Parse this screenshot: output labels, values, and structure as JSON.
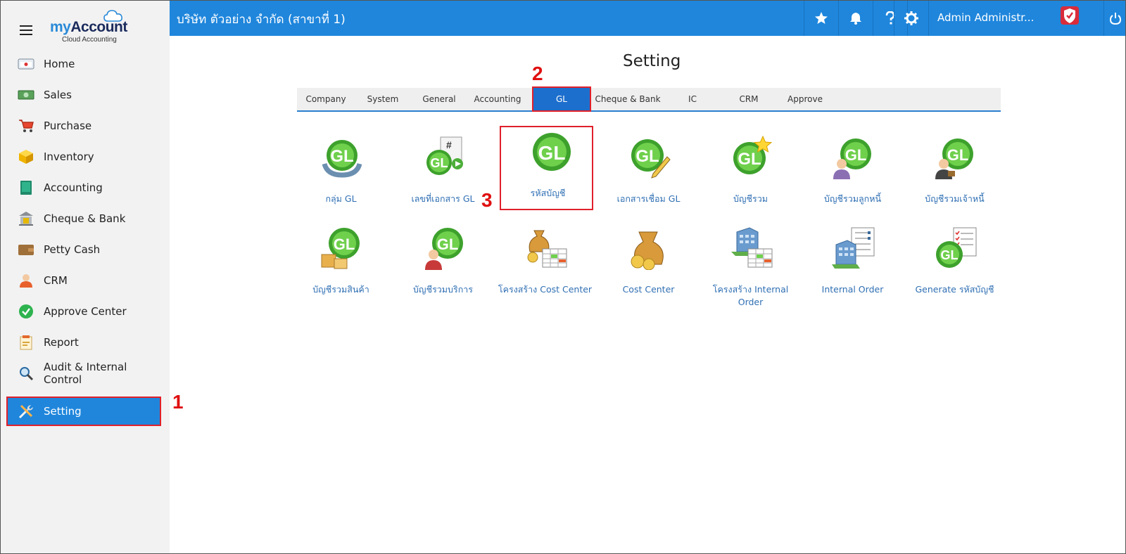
{
  "app": {
    "logo_main": "myAccount",
    "logo_sub": "Cloud Accounting"
  },
  "topbar": {
    "company": "บริษัท ตัวอย่าง จำกัด (สาขาที่ 1)",
    "user": "Admin Administr..."
  },
  "sidebar": {
    "items": [
      {
        "label": "Home"
      },
      {
        "label": "Sales"
      },
      {
        "label": "Purchase"
      },
      {
        "label": "Inventory"
      },
      {
        "label": "Accounting"
      },
      {
        "label": "Cheque & Bank"
      },
      {
        "label": "Petty Cash"
      },
      {
        "label": "CRM"
      },
      {
        "label": "Approve Center"
      },
      {
        "label": "Report"
      },
      {
        "label": "Audit & Internal Control"
      },
      {
        "label": "Setting"
      }
    ]
  },
  "main": {
    "title": "Setting",
    "tabs": [
      {
        "label": "Company"
      },
      {
        "label": "System"
      },
      {
        "label": "General"
      },
      {
        "label": "Accounting"
      },
      {
        "label": "GL"
      },
      {
        "label": "Cheque & Bank"
      },
      {
        "label": "IC"
      },
      {
        "label": "CRM"
      },
      {
        "label": "Approve"
      }
    ],
    "tiles_row1": [
      {
        "label": "กลุ่ม GL"
      },
      {
        "label": "เลขที่เอกสาร GL"
      },
      {
        "label": "รหัสบัญชี"
      },
      {
        "label": "เอกสารเชื่อม GL"
      },
      {
        "label": "บัญชีรวม"
      },
      {
        "label": "บัญชีรวมลูกหนี้"
      },
      {
        "label": "บัญชีรวมเจ้าหนี้"
      }
    ],
    "tiles_row2": [
      {
        "label": "บัญชีรวมสินค้า"
      },
      {
        "label": "บัญชีรวมบริการ"
      },
      {
        "label": "โครงสร้าง Cost Center"
      },
      {
        "label": "Cost Center"
      },
      {
        "label": "โครงสร้าง Internal Order"
      },
      {
        "label": "Internal Order"
      },
      {
        "label": "Generate รหัสบัญชี"
      }
    ]
  },
  "callouts": {
    "one": "1",
    "two": "2",
    "three": "3"
  },
  "colors": {
    "accent": "#1f86dc",
    "highlight": "#e0202a",
    "link": "#2f6fb3"
  }
}
